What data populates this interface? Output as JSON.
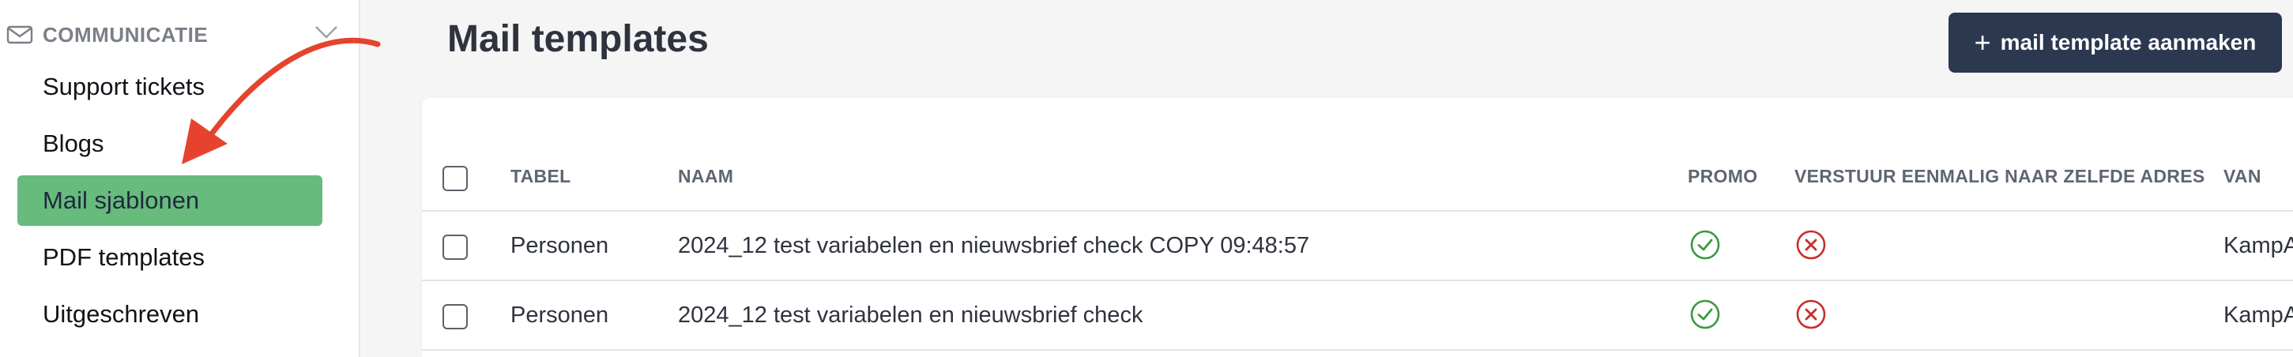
{
  "sidebar": {
    "section_title": "COMMUNICATIE",
    "section_icon": "envelope-icon",
    "collapse_icon": "chevron-down-icon",
    "items": [
      {
        "label": "Support tickets",
        "active": false
      },
      {
        "label": "Blogs",
        "active": false
      },
      {
        "label": "Mail sjablonen",
        "active": true
      },
      {
        "label": "PDF templates",
        "active": false
      },
      {
        "label": "Uitgeschreven",
        "active": false
      }
    ],
    "active_color": "#66bb7d",
    "arrow_color": "#e5432d"
  },
  "header": {
    "title": "Mail templates",
    "create_button_label": "mail template aanmaken",
    "create_button_color": "#2b3850"
  },
  "table": {
    "columns": [
      "TABEL",
      "NAAM",
      "PROMO",
      "VERSTUUR EENMALIG NAAR ZELFDE ADRES",
      "VAN"
    ],
    "rows": [
      {
        "tabel": "Personen",
        "naam": "2024_12 test variabelen en nieuwsbrief check COPY 09:48:57",
        "promo": "check-icon",
        "eenmalig": "cross-icon",
        "van": "KampA"
      },
      {
        "tabel": "Personen",
        "naam": "2024_12 test variabelen en nieuwsbrief check",
        "promo": "check-icon",
        "eenmalig": "cross-icon",
        "van": "KampA"
      }
    ],
    "check_color": "#3a9a3e",
    "cross_color": "#cc2b2b"
  }
}
